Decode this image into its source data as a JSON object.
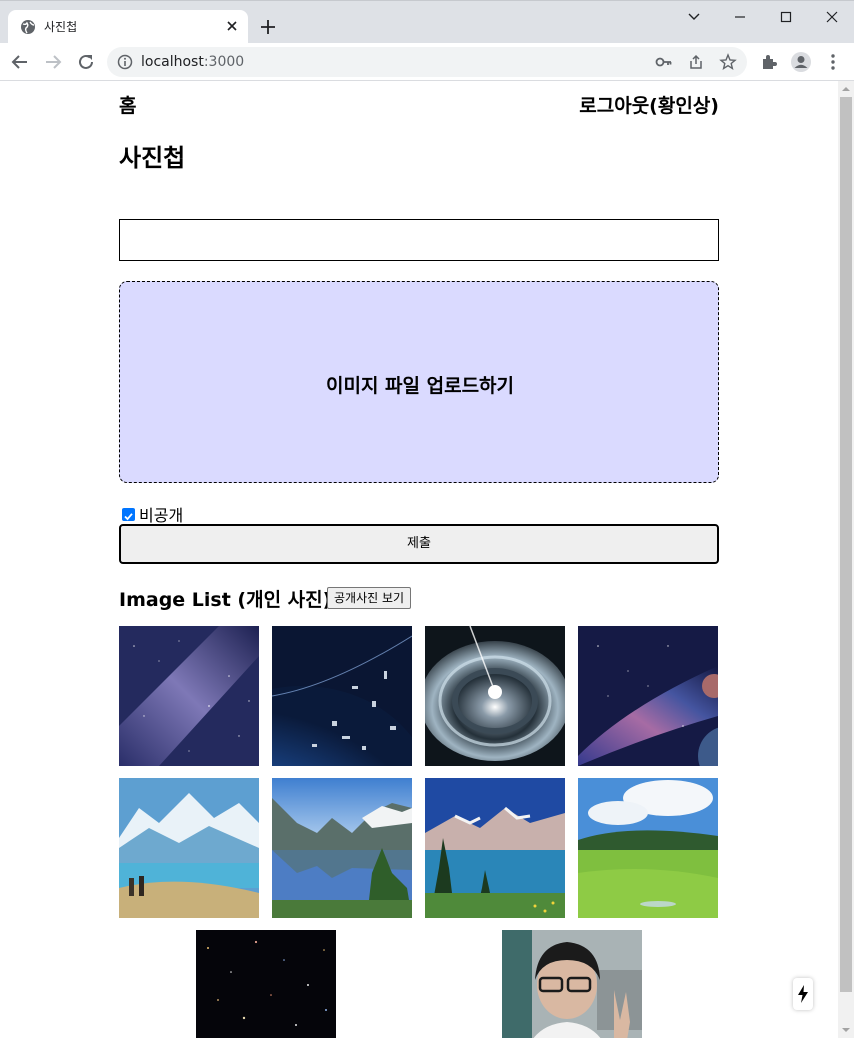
{
  "browser": {
    "tab_title": "사진첩",
    "url_host": "localhost",
    "url_port": ":3000"
  },
  "nav": {
    "home": "홈",
    "logout": "로그아웃(황인상)"
  },
  "page": {
    "title": "사진첩",
    "text_input_value": "",
    "dropzone_label": "이미지 파일 업로드하기",
    "private_checked": true,
    "private_label": "비공개",
    "submit_label": "제출",
    "list_title": "Image List (개인 사진)",
    "public_button": "공개사진 보기"
  },
  "images": [
    {
      "name": "milky-way-image"
    },
    {
      "name": "space-debris-earth-image"
    },
    {
      "name": "cosmic-eye-image"
    },
    {
      "name": "nebula-planet-image"
    },
    {
      "name": "mountain-hikers-lake-image"
    },
    {
      "name": "fjord-lake-reflection-image"
    },
    {
      "name": "mountain-lake-pines-image"
    },
    {
      "name": "green-grassland-image"
    },
    {
      "name": "star-field-image"
    },
    {
      "name": "person-selfie-image"
    }
  ],
  "colors": {
    "dropzone_bg": "#dadaff",
    "checkbox_accent": "#0075ff"
  }
}
